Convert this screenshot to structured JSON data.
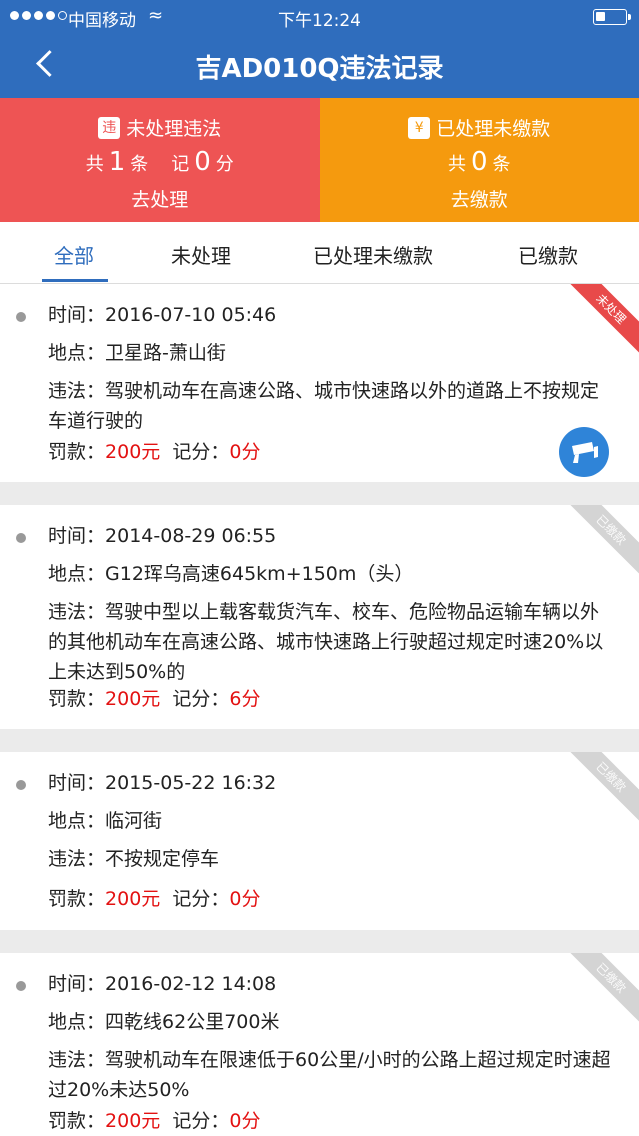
{
  "status": {
    "carrier": "中国移动",
    "time": "下午12:24"
  },
  "nav": {
    "title": "吉AD010Q违法记录"
  },
  "summary": {
    "unprocessed": {
      "badge": "违",
      "title": "未处理违法",
      "count_prefix": "共",
      "count": "1",
      "count_unit": "条",
      "points_prefix": "记",
      "points": "0",
      "points_unit": "分",
      "action": "去处理"
    },
    "unpaid": {
      "badge": "¥",
      "title": "已处理未缴款",
      "count_prefix": "共",
      "count": "0",
      "count_unit": "条",
      "action": "去缴款"
    }
  },
  "tabs": [
    "全部",
    "未处理",
    "已处理未缴款",
    "已缴款"
  ],
  "labels": {
    "time": "时间：",
    "place": "地点：",
    "violation": "违法：",
    "fine": "罚款：",
    "points": "记分："
  },
  "records": [
    {
      "status": "未处理",
      "time": "2016-07-10 05:46",
      "place": "卫星路-萧山街",
      "violation": "驾驶机动车在高速公路、城市快速路以外的道路上不按规定车道行驶的",
      "fine": "200元",
      "points": "0分",
      "camera_icon": "camera-icon"
    },
    {
      "status": "已缴款",
      "time": "2014-08-29 06:55",
      "place": "G12珲乌高速645km+150m（头）",
      "violation": "驾驶中型以上载客载货汽车、校车、危险物品运输车辆以外的其他机动车在高速公路、城市快速路上行驶超过规定时速20%以上未达到50%的",
      "fine": "200元",
      "points": "6分"
    },
    {
      "status": "已缴款",
      "time": "2015-05-22 16:32",
      "place": "临河街",
      "violation": "不按规定停车",
      "fine": "200元",
      "points": "0分"
    },
    {
      "status": "已缴款",
      "time": "2016-02-12 14:08",
      "place": "四乾线62公里700米",
      "violation": "驾驶机动车在限速低于60公里/小时的公路上超过规定时速超过20%未达50%",
      "fine": "200元",
      "points": "0分"
    }
  ],
  "colors": {
    "nav_blue": "#2f6dbd",
    "unprocessed_red": "#ee5454",
    "unpaid_orange": "#f59a0e",
    "money_red": "#e31212"
  }
}
